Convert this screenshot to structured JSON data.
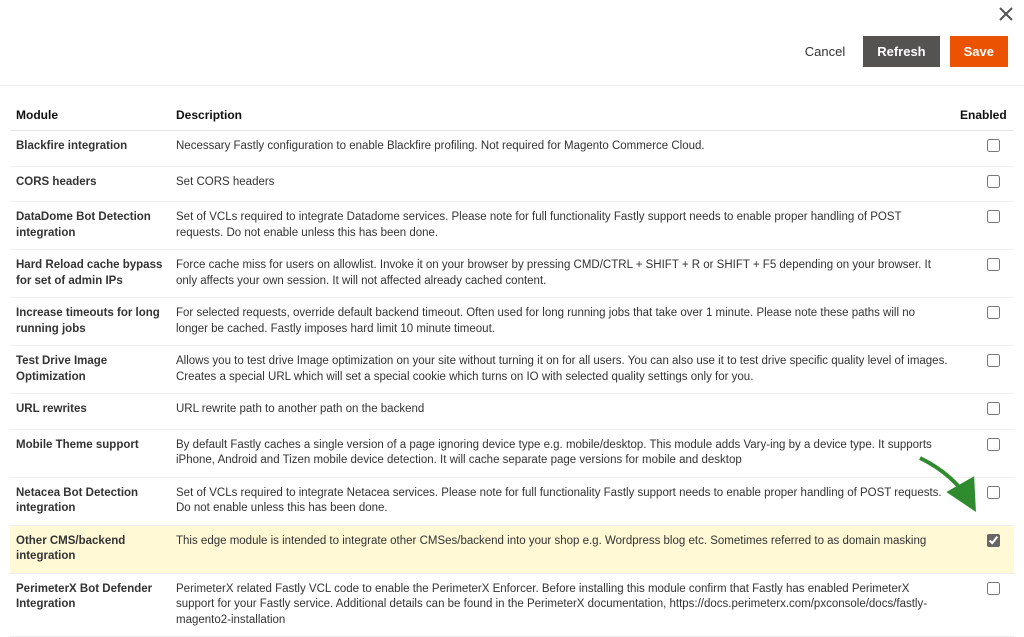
{
  "actions": {
    "cancel": "Cancel",
    "refresh": "Refresh",
    "save": "Save"
  },
  "headers": {
    "module": "Module",
    "description": "Description",
    "enabled": "Enabled"
  },
  "rows": [
    {
      "module": "Blackfire integration",
      "description": "Necessary Fastly configuration to enable Blackfire profiling. Not required for Magento Commerce Cloud.",
      "enabled": false,
      "highlight": false
    },
    {
      "module": "CORS headers",
      "description": "Set CORS headers",
      "enabled": false,
      "highlight": false
    },
    {
      "module": "DataDome Bot Detection integration",
      "description": "Set of VCLs required to integrate Datadome services. Please note for full functionality Fastly support needs to enable proper handling of POST requests. Do not enable unless this has been done.",
      "enabled": false,
      "highlight": false
    },
    {
      "module": "Hard Reload cache bypass for set of admin IPs",
      "description": "Force cache miss for users on allowlist. Invoke it on your browser by pressing CMD/CTRL + SHIFT + R or SHIFT + F5 depending on your browser. It only affects your own session. It will not affected already cached content.",
      "enabled": false,
      "highlight": false
    },
    {
      "module": "Increase timeouts for long running jobs",
      "description": "For selected requests, override default backend timeout. Often used for long running jobs that take over 1 minute. Please note these paths will no longer be cached. Fastly imposes hard limit 10 minute timeout.",
      "enabled": false,
      "highlight": false
    },
    {
      "module": "Test Drive Image Optimization",
      "description": "Allows you to test drive Image optimization on your site without turning it on for all users. You can also use it to test drive specific quality level of images. Creates a special URL which will set a special cookie which turns on IO with selected quality settings only for you.",
      "enabled": false,
      "highlight": false
    },
    {
      "module": "URL rewrites",
      "description": "URL rewrite path to another path on the backend",
      "enabled": false,
      "highlight": false
    },
    {
      "module": "Mobile Theme support",
      "description": "By default Fastly caches a single version of a page ignoring device type e.g. mobile/desktop. This module adds Vary-ing by a device type. It supports iPhone, Android and Tizen mobile device detection. It will cache separate page versions for mobile and desktop",
      "enabled": false,
      "highlight": false
    },
    {
      "module": "Netacea Bot Detection integration",
      "description": "Set of VCLs required to integrate Netacea services. Please note for full functionality Fastly support needs to enable proper handling of POST requests. Do not enable unless this has been done.",
      "enabled": false,
      "highlight": false
    },
    {
      "module": "Other CMS/backend integration",
      "description": "This edge module is intended to integrate other CMSes/backend into your shop e.g. Wordpress blog etc. Sometimes referred to as domain masking",
      "enabled": true,
      "highlight": true
    },
    {
      "module": "PerimeterX Bot Defender Integration",
      "description": "PerimeterX related Fastly VCL code to enable the PerimeterX Enforcer. Before installing this module confirm that Fastly has enabled PerimeterX support for your Fastly service. Additional details can be found in the PerimeterX documentation, https://docs.perimeterx.com/pxconsole/docs/fastly-magento2-installation",
      "enabled": false,
      "highlight": false
    }
  ],
  "colors": {
    "primary": "#eb5202",
    "secondary": "#545351",
    "highlight_bg": "#fff9d6",
    "arrow": "#2e8b2e"
  }
}
